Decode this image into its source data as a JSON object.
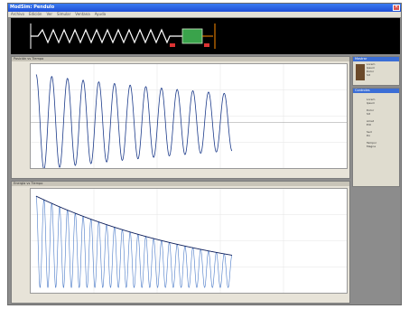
{
  "window": {
    "title": "ModSim: Pendulo"
  },
  "menu": [
    "Archivo",
    "Edición",
    "Ver",
    "Simular",
    "Ventana",
    "Ayuda"
  ],
  "panels": {
    "top": {
      "title": "Posición vs Tiempo"
    },
    "bottom": {
      "title": "Energía vs Tiempo"
    }
  },
  "sidebar": {
    "top": {
      "title": "Mostrar",
      "lines": [
        "Lorem",
        "Ipsum",
        "Dolor",
        "Sit"
      ]
    },
    "bottom": {
      "title": "Controles",
      "groups": [
        [
          "Lorem",
          "Ipsum"
        ],
        [
          "Dolor",
          "Sit"
        ],
        [
          "Amet",
          "Elit"
        ],
        [
          "Sed",
          "Do"
        ],
        [
          "Tempor",
          "Magna"
        ]
      ]
    }
  },
  "colors": {
    "title_bar": "#1f4fd6",
    "mass": "#3aa34b",
    "wave": "#1b3a8a",
    "envelope": "#0d1e5a"
  },
  "chart_data": [
    {
      "type": "line",
      "title": "",
      "series": [
        {
          "name": "",
          "amplitude_start": 1.0,
          "decay": 0.52,
          "cycles": 12.5,
          "t_end": 0.62
        }
      ],
      "grid": true
    },
    {
      "type": "area",
      "title": "",
      "series": [
        {
          "name": "",
          "amplitude_start": 1.0,
          "decay": 1.04,
          "cycles": 25,
          "t_end": 0.62
        }
      ],
      "grid": true
    }
  ]
}
